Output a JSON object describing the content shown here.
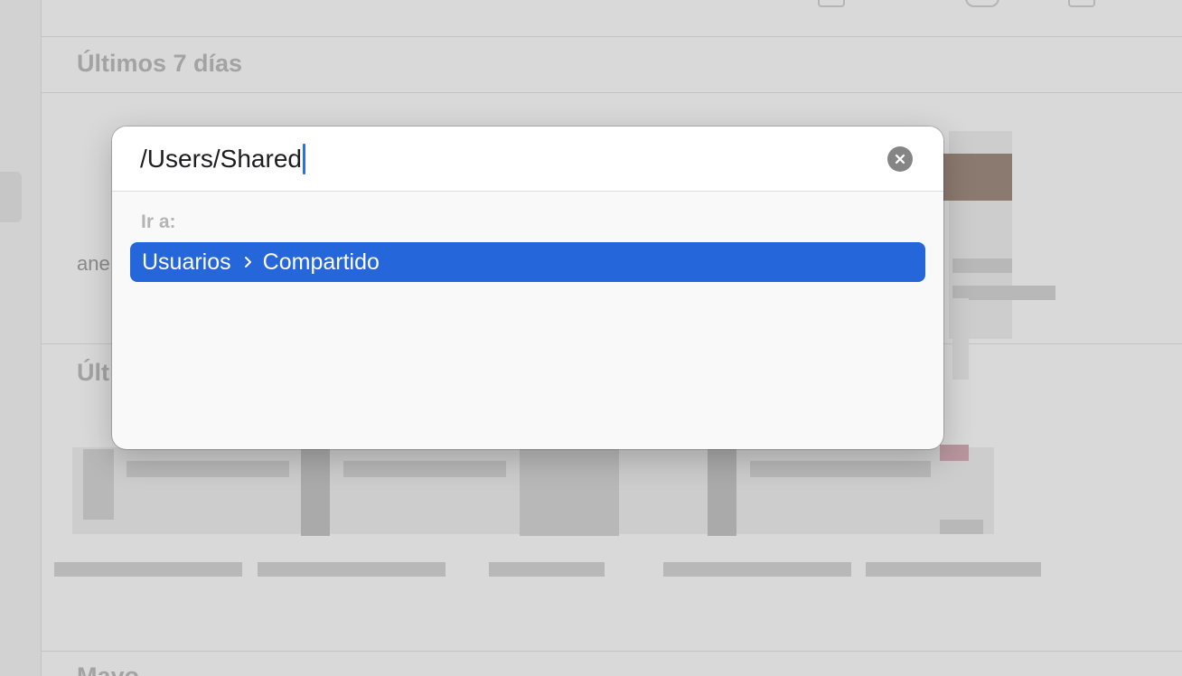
{
  "background": {
    "section_recent": "Últimos 7 días",
    "section_prev_partial": "Últ",
    "section_bottom_partial": "Mayo",
    "file_label_partial": "ane"
  },
  "dialog": {
    "path_value": "/Users/Shared",
    "goto_label": "Ir a:",
    "suggestion": {
      "segments": [
        "Usuarios",
        "Compartido"
      ],
      "separator_icon": "chevron-right-icon"
    },
    "clear_icon": "clear-x-icon"
  },
  "colors": {
    "selection_blue": "#2566da",
    "caret_blue": "#2b6fe6",
    "clear_button_gray": "#858585"
  }
}
